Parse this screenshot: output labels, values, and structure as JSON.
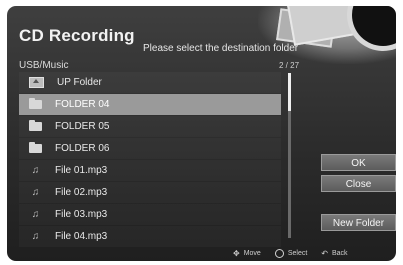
{
  "dialog": {
    "title": "CD Recording",
    "instruction": "Please select the destination folder",
    "path": "USB/Music",
    "counter": "2 / 27"
  },
  "items": [
    {
      "label": "UP Folder",
      "icon": "up-folder-icon",
      "selected": false
    },
    {
      "label": "FOLDER 04",
      "icon": "folder-icon",
      "selected": true
    },
    {
      "label": "FOLDER 05",
      "icon": "folder-icon",
      "selected": false
    },
    {
      "label": "FOLDER 06",
      "icon": "folder-icon",
      "selected": false
    },
    {
      "label": "File 01.mp3",
      "icon": "music-file-icon",
      "selected": false
    },
    {
      "label": "File 02.mp3",
      "icon": "music-file-icon",
      "selected": false
    },
    {
      "label": "File 03.mp3",
      "icon": "music-file-icon",
      "selected": false
    },
    {
      "label": "File 04.mp3",
      "icon": "music-file-icon",
      "selected": false
    }
  ],
  "buttons": {
    "ok": "OK",
    "close": "Close",
    "new_folder": "New Folder"
  },
  "hints": {
    "move": "Move",
    "select": "Select",
    "back": "Back"
  },
  "colors": {
    "selection": "#9a9a9a",
    "background": "#333333"
  }
}
